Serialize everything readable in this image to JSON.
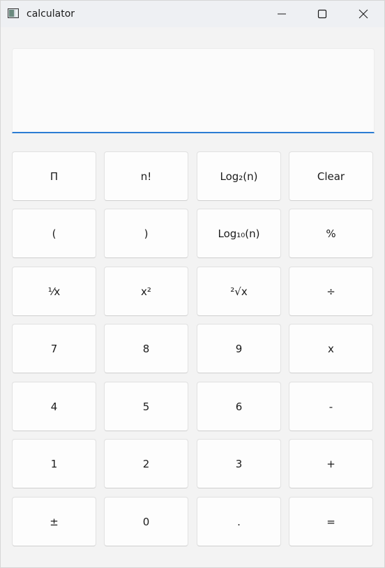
{
  "window": {
    "title": "calculator",
    "icon": "calculator-app-icon",
    "controls": {
      "minimize": "minimize-icon",
      "maximize": "maximize-icon",
      "close": "close-icon"
    }
  },
  "display": {
    "value": ""
  },
  "keys": [
    [
      "Π",
      "n!",
      "Log₂(n)",
      "Clear"
    ],
    [
      "(",
      ")",
      "Log₁₀(n)",
      "%"
    ],
    [
      "⅟x",
      "x²",
      "²√x",
      "÷"
    ],
    [
      "7",
      "8",
      "9",
      "x"
    ],
    [
      "4",
      "5",
      "6",
      "-"
    ],
    [
      "1",
      "2",
      "3",
      "+"
    ],
    [
      "±",
      "0",
      ".",
      "="
    ]
  ],
  "key_names": [
    [
      "pi-button",
      "factorial-button",
      "log2-button",
      "clear-button"
    ],
    [
      "open-paren-button",
      "close-paren-button",
      "log10-button",
      "percent-button"
    ],
    [
      "reciprocal-button",
      "square-button",
      "square-root-button",
      "divide-button"
    ],
    [
      "digit-7-button",
      "digit-8-button",
      "digit-9-button",
      "multiply-button"
    ],
    [
      "digit-4-button",
      "digit-5-button",
      "digit-6-button",
      "subtract-button"
    ],
    [
      "digit-1-button",
      "digit-2-button",
      "digit-3-button",
      "add-button"
    ],
    [
      "negate-button",
      "digit-0-button",
      "decimal-point-button",
      "equals-button"
    ]
  ],
  "colors": {
    "accent": "#2b7cd3",
    "background": "#f3f3f3",
    "key_background": "#fdfdfd"
  }
}
